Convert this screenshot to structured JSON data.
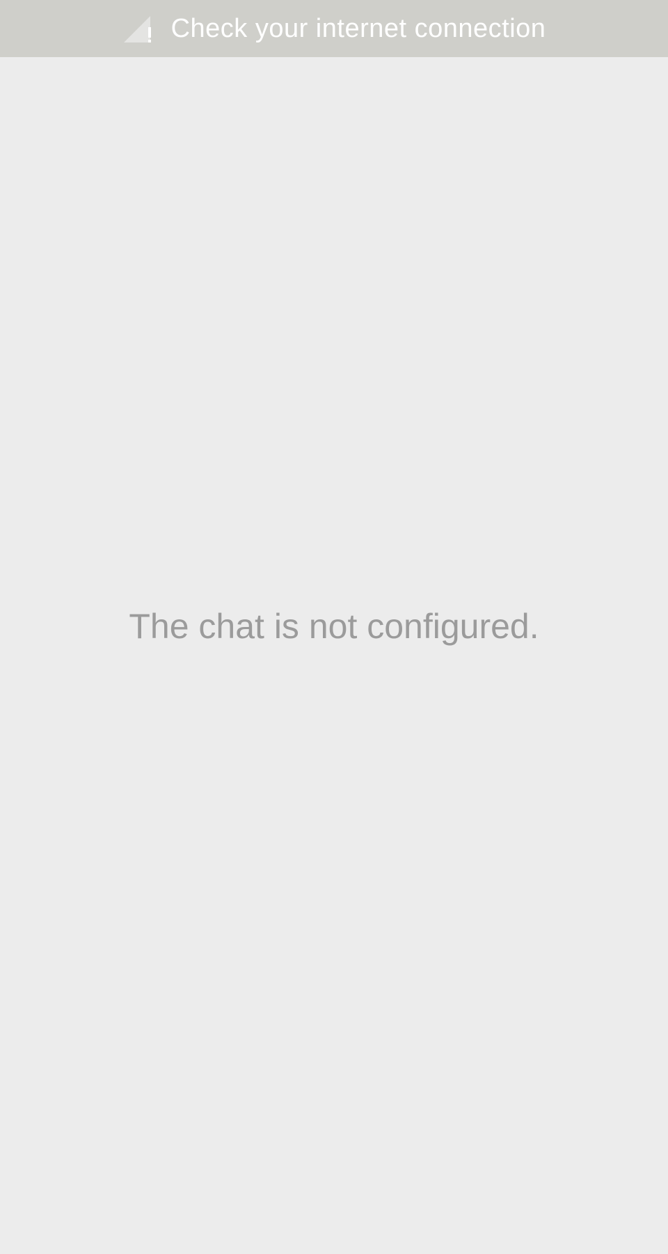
{
  "banner": {
    "icon": "signal-warning-icon",
    "text": "Check your internet connection",
    "background": "#cfcfca",
    "text_color": "#ffffff"
  },
  "main": {
    "empty_message": "The chat is not configured.",
    "background": "#ececec",
    "text_color": "#9b9b9b"
  }
}
